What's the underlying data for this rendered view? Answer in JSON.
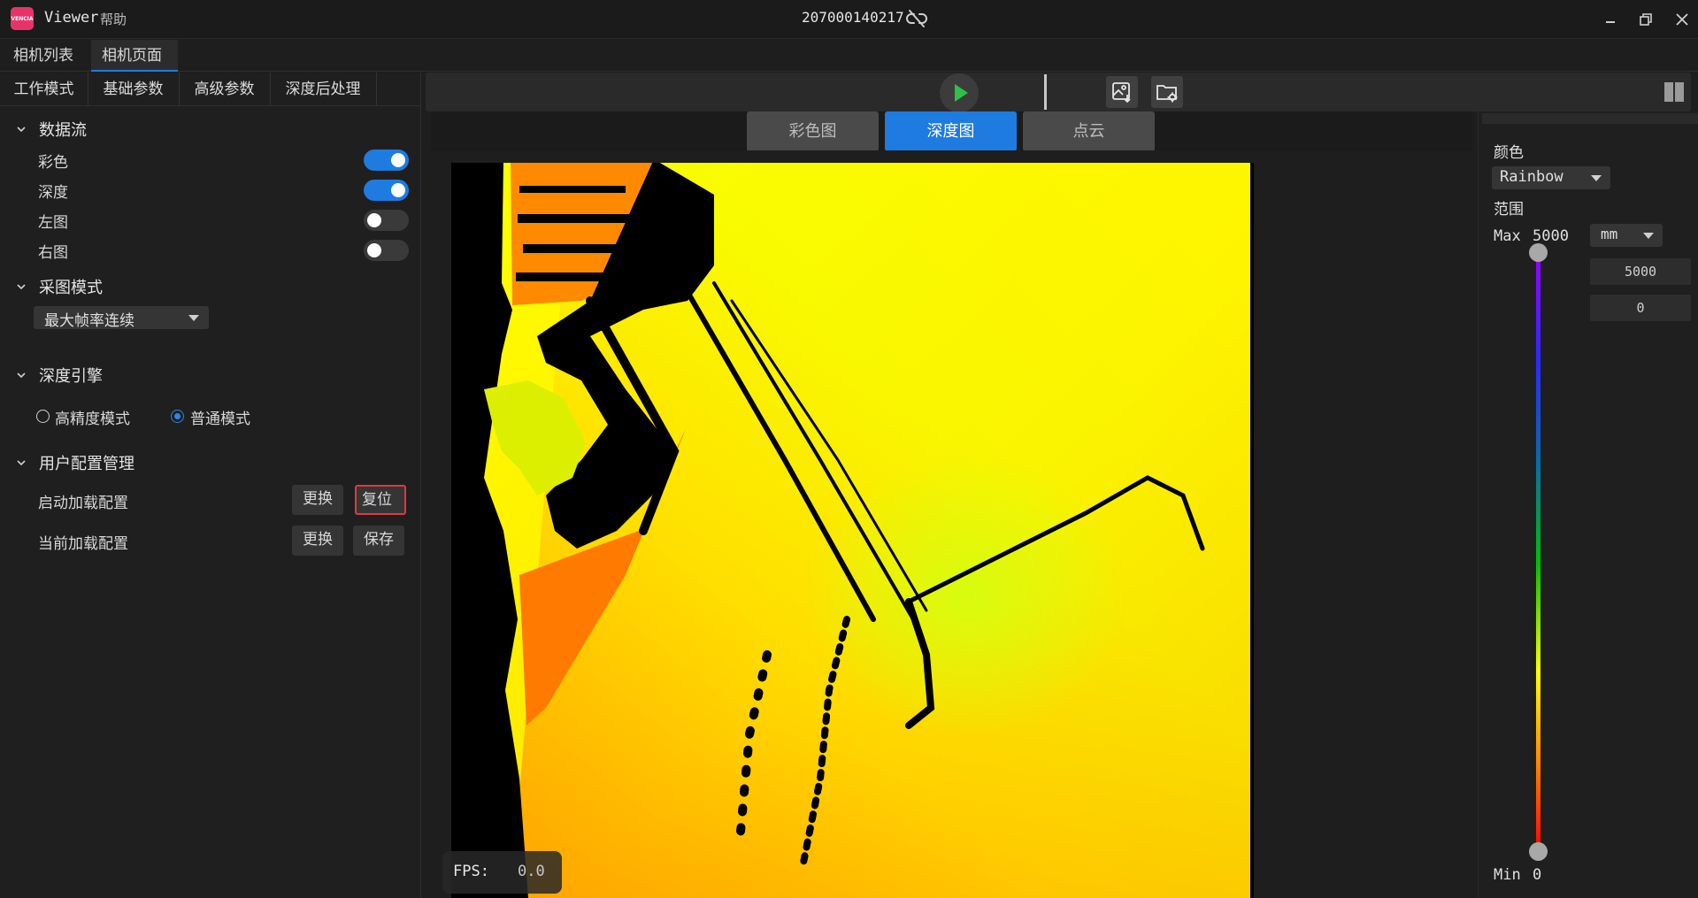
{
  "title_bar": {
    "logo_text": "VENCIA",
    "app_name": "Viewer",
    "menu_help": "帮助",
    "serial": "207000140217",
    "icons": [
      "unlink-icon",
      "minimize-icon",
      "restore-icon",
      "close-icon"
    ]
  },
  "top_tabs": [
    {
      "label": "相机列表",
      "active": false
    },
    {
      "label": "相机页面",
      "active": true
    }
  ],
  "sub_tabs": [
    "工作模式",
    "基础参数",
    "高级参数",
    "深度后处理"
  ],
  "data_stream": {
    "title": "数据流",
    "items": [
      {
        "label": "彩色",
        "on": true
      },
      {
        "label": "深度",
        "on": true
      },
      {
        "label": "左图",
        "on": false
      },
      {
        "label": "右图",
        "on": false
      }
    ]
  },
  "capture_mode": {
    "title": "采图模式",
    "selected": "最大帧率连续"
  },
  "depth_engine": {
    "title": "深度引擎",
    "options": [
      {
        "label": "高精度模式",
        "checked": false
      },
      {
        "label": "普通模式",
        "checked": true
      }
    ]
  },
  "user_config": {
    "title": "用户配置管理",
    "rows": [
      {
        "label": "启动加载配置",
        "btn1": "更换",
        "btn2": "复位"
      },
      {
        "label": "当前加载配置",
        "btn1": "更换",
        "btn2": "保存"
      }
    ]
  },
  "view_tabs": [
    {
      "label": "彩色图",
      "active": false
    },
    {
      "label": "深度图",
      "active": true
    },
    {
      "label": "点云",
      "active": false
    }
  ],
  "fps": {
    "label": "FPS:",
    "value": "0.0"
  },
  "right_panel": {
    "color_label": "颜色",
    "colormap": "Rainbow",
    "range_label": "范围",
    "max_label": "Max",
    "max_value": "5000",
    "unit": "mm",
    "field_max": "5000",
    "field_min": "0",
    "min_label": "Min",
    "min_value": "0"
  },
  "colors": {
    "accent": "#1e7be0",
    "play": "#2fbf4a",
    "highlight_border": "#e0393e"
  }
}
